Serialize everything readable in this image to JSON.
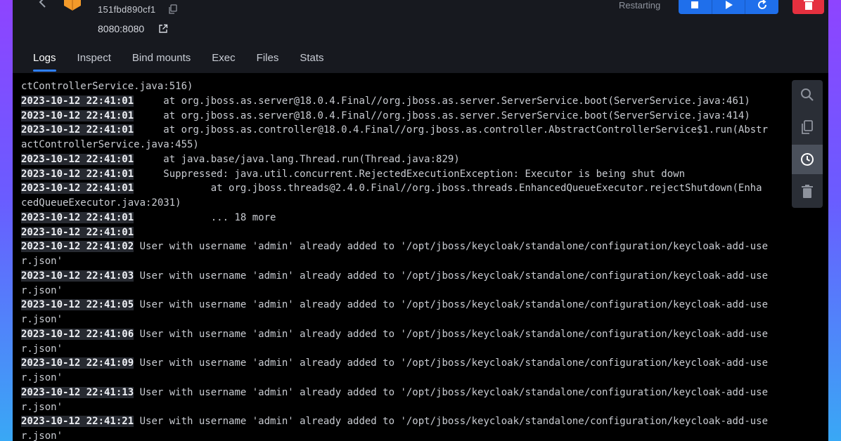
{
  "header": {
    "container_id": "151fbd890cf1",
    "port": "8080:8080",
    "status": "Restarting"
  },
  "tabs": [
    "Logs",
    "Inspect",
    "Bind mounts",
    "Exec",
    "Files",
    "Stats"
  ],
  "active_tab": "Logs",
  "logs": [
    {
      "ts": "",
      "text": "ctControllerService.java:516)"
    },
    {
      "ts": "2023-10-12 22:41:01",
      "text": "     at org.jboss.as.server@18.0.4.Final//org.jboss.as.server.ServerService.boot(ServerService.java:461)"
    },
    {
      "ts": "2023-10-12 22:41:01",
      "text": "     at org.jboss.as.server@18.0.4.Final//org.jboss.as.server.ServerService.boot(ServerService.java:414)"
    },
    {
      "ts": "2023-10-12 22:41:01",
      "text": "     at org.jboss.as.controller@18.0.4.Final//org.jboss.as.controller.AbstractControllerService$1.run(Abstr"
    },
    {
      "ts": "",
      "text": "actControllerService.java:455)"
    },
    {
      "ts": "2023-10-12 22:41:01",
      "text": "     at java.base/java.lang.Thread.run(Thread.java:829)"
    },
    {
      "ts": "2023-10-12 22:41:01",
      "text": "     Suppressed: java.util.concurrent.RejectedExecutionException: Executor is being shut down"
    },
    {
      "ts": "2023-10-12 22:41:01",
      "text": "             at org.jboss.threads@2.4.0.Final//org.jboss.threads.EnhancedQueueExecutor.rejectShutdown(Enha"
    },
    {
      "ts": "",
      "text": "cedQueueExecutor.java:2031)"
    },
    {
      "ts": "2023-10-12 22:41:01",
      "text": "             ... 18 more"
    },
    {
      "ts": "2023-10-12 22:41:01",
      "text": ""
    },
    {
      "ts": "2023-10-12 22:41:02",
      "text": " User with username 'admin' already added to '/opt/jboss/keycloak/standalone/configuration/keycloak-add-use"
    },
    {
      "ts": "",
      "text": "r.json'"
    },
    {
      "ts": "2023-10-12 22:41:03",
      "text": " User with username 'admin' already added to '/opt/jboss/keycloak/standalone/configuration/keycloak-add-use"
    },
    {
      "ts": "",
      "text": "r.json'"
    },
    {
      "ts": "2023-10-12 22:41:05",
      "text": " User with username 'admin' already added to '/opt/jboss/keycloak/standalone/configuration/keycloak-add-use"
    },
    {
      "ts": "",
      "text": "r.json'"
    },
    {
      "ts": "2023-10-12 22:41:06",
      "text": " User with username 'admin' already added to '/opt/jboss/keycloak/standalone/configuration/keycloak-add-use"
    },
    {
      "ts": "",
      "text": "r.json'"
    },
    {
      "ts": "2023-10-12 22:41:09",
      "text": " User with username 'admin' already added to '/opt/jboss/keycloak/standalone/configuration/keycloak-add-use"
    },
    {
      "ts": "",
      "text": "r.json'"
    },
    {
      "ts": "2023-10-12 22:41:13",
      "text": " User with username 'admin' already added to '/opt/jboss/keycloak/standalone/configuration/keycloak-add-use"
    },
    {
      "ts": "",
      "text": "r.json'"
    },
    {
      "ts": "2023-10-12 22:41:21",
      "text": " User with username 'admin' already added to '/opt/jboss/keycloak/standalone/configuration/keycloak-add-use"
    },
    {
      "ts": "",
      "text": "r.json'"
    }
  ],
  "icons": {
    "back": "arrow-left-icon",
    "container": "cube-icon",
    "copy": "copy-icon",
    "external": "external-link-icon",
    "stop": "stop-icon",
    "start": "play-icon",
    "restart": "restart-icon",
    "delete": "trash-icon",
    "search": "search-icon",
    "copy_logs": "copy-icon",
    "timestamps": "clock-icon",
    "clear": "trash-icon"
  },
  "colors": {
    "accent": "#1f6feb",
    "danger": "#e5303f",
    "background": "#17191f",
    "log_background": "#000000"
  }
}
